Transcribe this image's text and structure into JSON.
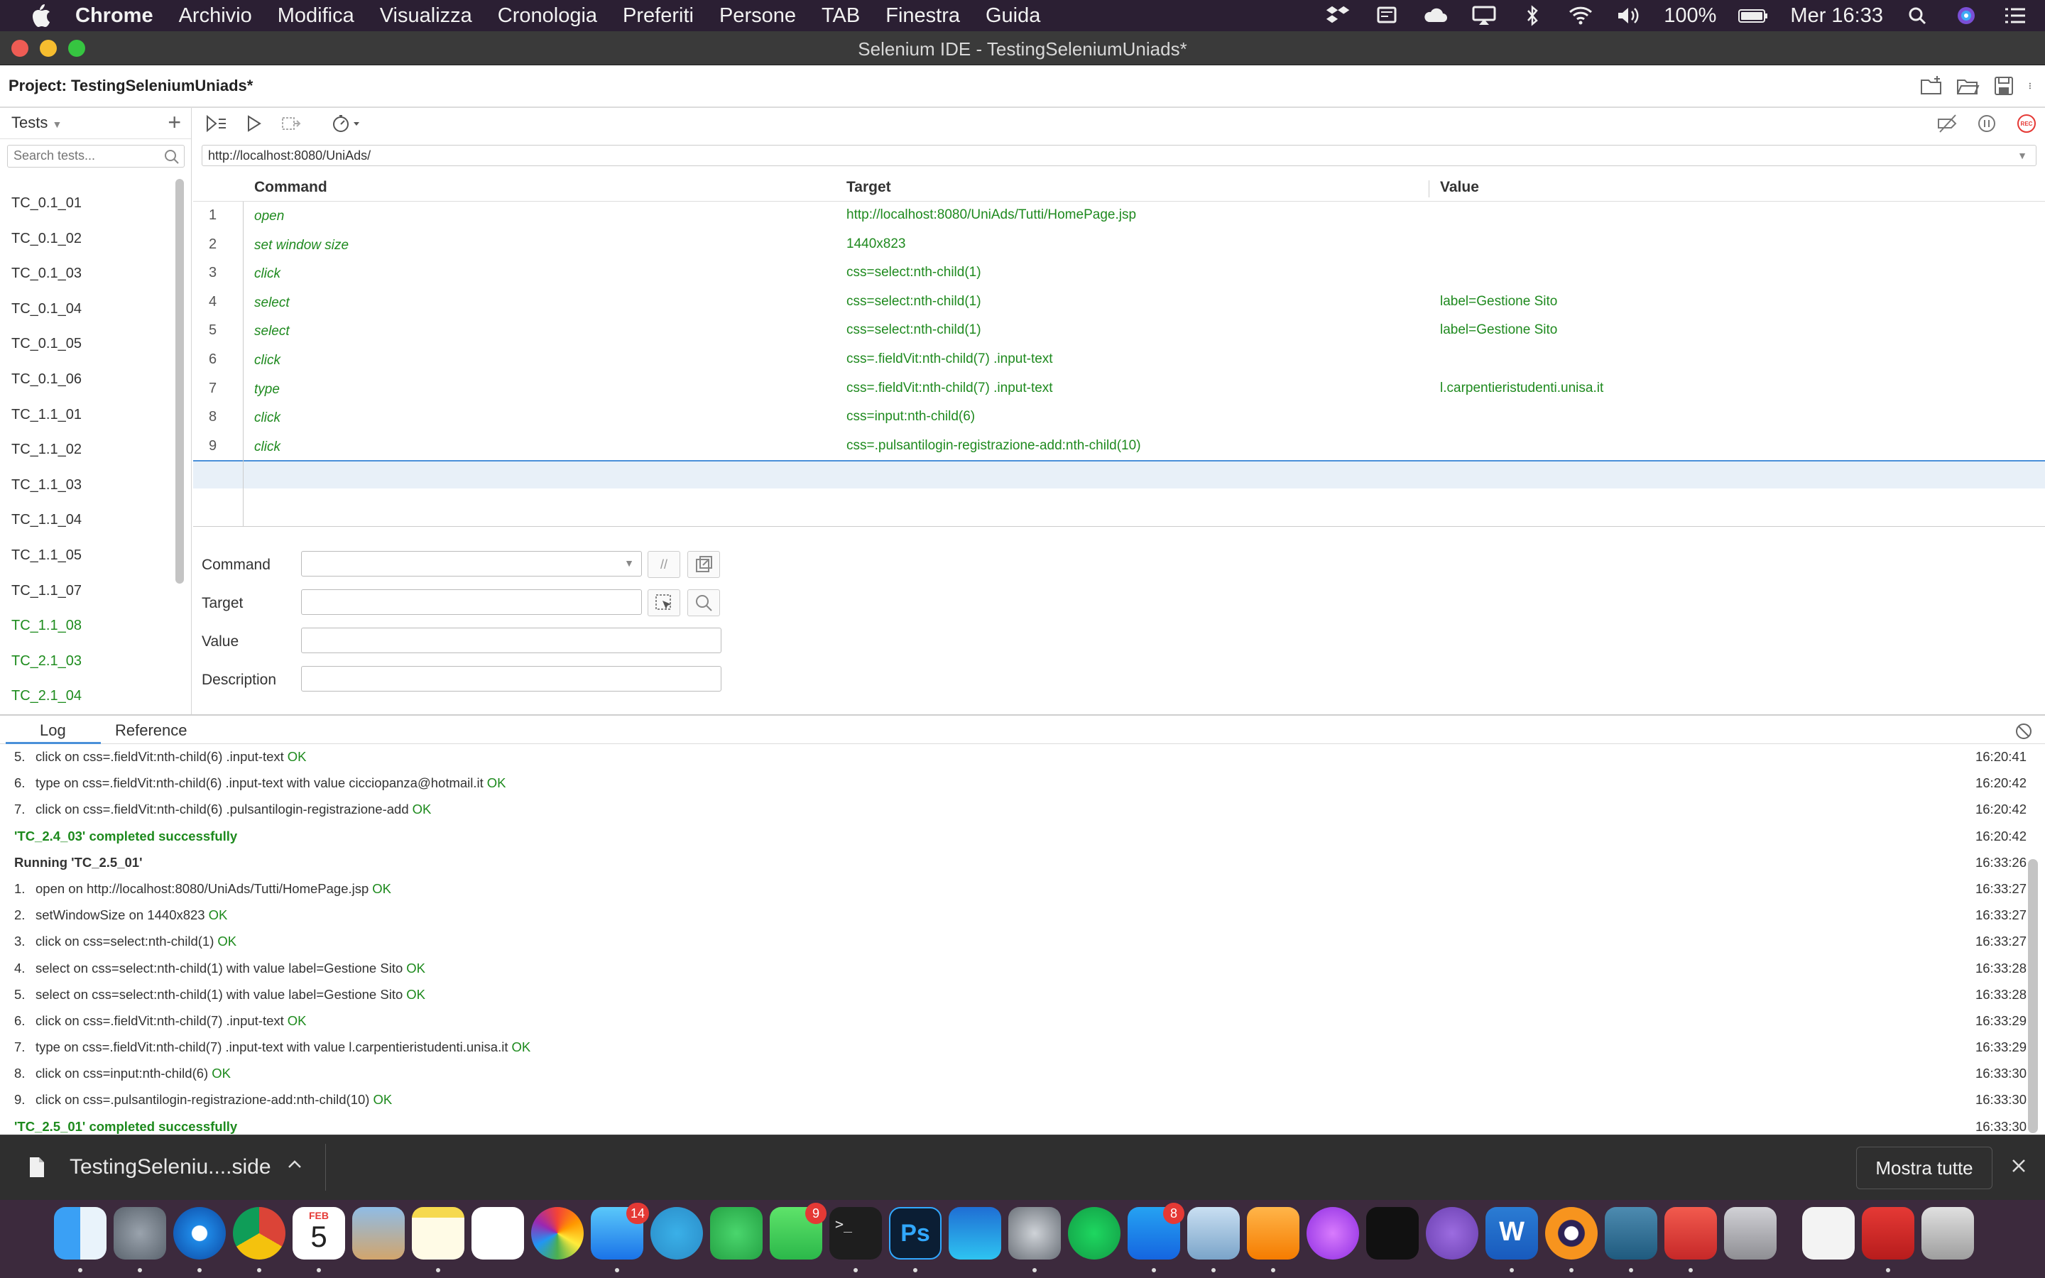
{
  "menubar": {
    "app": "Chrome",
    "items": [
      "Archivio",
      "Modifica",
      "Visualizza",
      "Cronologia",
      "Preferiti",
      "Persone",
      "TAB",
      "Finestra",
      "Guida"
    ],
    "battery": "100%",
    "clock": "Mer 16:33"
  },
  "window": {
    "title": "Selenium IDE - TestingSeleniumUniads*"
  },
  "project": {
    "label": "Project:  TestingSeleniumUniads*"
  },
  "tests": {
    "header": "Tests",
    "search_placeholder": "Search tests...",
    "items": [
      {
        "name": "TC_0.1_01",
        "passed": false
      },
      {
        "name": "TC_0.1_02",
        "passed": false
      },
      {
        "name": "TC_0.1_03",
        "passed": false
      },
      {
        "name": "TC_0.1_04",
        "passed": false
      },
      {
        "name": "TC_0.1_05",
        "passed": false
      },
      {
        "name": "TC_0.1_06",
        "passed": false
      },
      {
        "name": "TC_1.1_01",
        "passed": false
      },
      {
        "name": "TC_1.1_02",
        "passed": false
      },
      {
        "name": "TC_1.1_03",
        "passed": false
      },
      {
        "name": "TC_1.1_04",
        "passed": false
      },
      {
        "name": "TC_1.1_05",
        "passed": false
      },
      {
        "name": "TC_1.1_07",
        "passed": false
      },
      {
        "name": "TC_1.1_08",
        "passed": true
      },
      {
        "name": "TC_2.1_03",
        "passed": true
      },
      {
        "name": "TC_2.1_04",
        "passed": true
      }
    ]
  },
  "url": "http://localhost:8080/UniAds/",
  "table": {
    "headers": {
      "command": "Command",
      "target": "Target",
      "value": "Value"
    },
    "rows": [
      {
        "n": "1",
        "command": "open",
        "target": "http://localhost:8080/UniAds/Tutti/HomePage.jsp",
        "value": ""
      },
      {
        "n": "2",
        "command": "set window size",
        "target": "1440x823",
        "value": ""
      },
      {
        "n": "3",
        "command": "click",
        "target": "css=select:nth-child(1)",
        "value": ""
      },
      {
        "n": "4",
        "command": "select",
        "target": "css=select:nth-child(1)",
        "value": "label=Gestione Sito"
      },
      {
        "n": "5",
        "command": "select",
        "target": "css=select:nth-child(1)",
        "value": "label=Gestione Sito"
      },
      {
        "n": "6",
        "command": "click",
        "target": "css=.fieldVit:nth-child(7) .input-text",
        "value": ""
      },
      {
        "n": "7",
        "command": "type",
        "target": "css=.fieldVit:nth-child(7) .input-text",
        "value": "l.carpentieristudenti.unisa.it"
      },
      {
        "n": "8",
        "command": "click",
        "target": "css=input:nth-child(6)",
        "value": ""
      },
      {
        "n": "9",
        "command": "click",
        "target": "css=.pulsantilogin-registrazione-add:nth-child(10)",
        "value": ""
      }
    ]
  },
  "editor": {
    "command_label": "Command",
    "target_label": "Target",
    "value_label": "Value",
    "description_label": "Description",
    "comment_btn": "//"
  },
  "log": {
    "tabs": [
      "Log",
      "Reference"
    ],
    "lines": [
      {
        "num": "5.",
        "text": "click on css=.fieldVit:nth-child(6) .input-text",
        "ok": "OK",
        "time": "16:20:41",
        "style": "step"
      },
      {
        "num": "6.",
        "text": "type on css=.fieldVit:nth-child(6) .input-text with value cicciopanza@hotmail.it",
        "ok": "OK",
        "time": "16:20:42",
        "style": "step"
      },
      {
        "num": "7.",
        "text": "click on css=.fieldVit:nth-child(6) .pulsantilogin-registrazione-add",
        "ok": "OK",
        "time": "16:20:42",
        "style": "step"
      },
      {
        "num": "",
        "text": "'TC_2.4_03' completed successfully",
        "ok": "",
        "time": "16:20:42",
        "style": "success"
      },
      {
        "num": "",
        "text": "Running 'TC_2.5_01'",
        "ok": "",
        "time": "16:33:26",
        "style": "running"
      },
      {
        "num": "1.",
        "text": "open on http://localhost:8080/UniAds/Tutti/HomePage.jsp",
        "ok": "OK",
        "time": "16:33:27",
        "style": "step"
      },
      {
        "num": "2.",
        "text": "setWindowSize on 1440x823",
        "ok": "OK",
        "time": "16:33:27",
        "style": "step"
      },
      {
        "num": "3.",
        "text": "click on css=select:nth-child(1)",
        "ok": "OK",
        "time": "16:33:27",
        "style": "step"
      },
      {
        "num": "4.",
        "text": "select on css=select:nth-child(1) with value label=Gestione Sito",
        "ok": "OK",
        "time": "16:33:28",
        "style": "step"
      },
      {
        "num": "5.",
        "text": "select on css=select:nth-child(1) with value label=Gestione Sito",
        "ok": "OK",
        "time": "16:33:28",
        "style": "step"
      },
      {
        "num": "6.",
        "text": "click on css=.fieldVit:nth-child(7) .input-text",
        "ok": "OK",
        "time": "16:33:29",
        "style": "step"
      },
      {
        "num": "7.",
        "text": "type on css=.fieldVit:nth-child(7) .input-text with value l.carpentieristudenti.unisa.it",
        "ok": "OK",
        "time": "16:33:29",
        "style": "step"
      },
      {
        "num": "8.",
        "text": "click on css=input:nth-child(6)",
        "ok": "OK",
        "time": "16:33:30",
        "style": "step"
      },
      {
        "num": "9.",
        "text": "click on css=.pulsantilogin-registrazione-add:nth-child(10)",
        "ok": "OK",
        "time": "16:33:30",
        "style": "step"
      },
      {
        "num": "",
        "text": "'TC_2.5_01' completed successfully",
        "ok": "",
        "time": "16:33:30",
        "style": "success"
      }
    ]
  },
  "downloads": {
    "file": "TestingSeleniu....side",
    "show_all": "Mostra tutte"
  },
  "dock": {
    "calendar_month": "FEB",
    "calendar_day": "5",
    "badges": {
      "telegram_like": "14",
      "facetime": "9",
      "appstore": "8"
    },
    "items": [
      "finder",
      "launchpad",
      "safari",
      "chrome",
      "calendar",
      "preview-bird",
      "notes",
      "reminders",
      "photos",
      "messages",
      "telegram",
      "whatsapp",
      "facetime",
      "terminal",
      "photoshop",
      "sky-go",
      "system-preferences",
      "spotify",
      "app-store",
      "preview",
      "pages",
      "podcasts",
      "apple-tv",
      "github",
      "word",
      "eclipse",
      "mysql-workbench",
      "git-tool",
      "bbedit",
      "documents",
      "selenium-ide",
      "trash"
    ]
  },
  "colors": {
    "pass_green": "#1f8a1f",
    "menubar": "#2b1f33",
    "accent_blue": "#4a90d9",
    "rec_red": "#e53935"
  }
}
